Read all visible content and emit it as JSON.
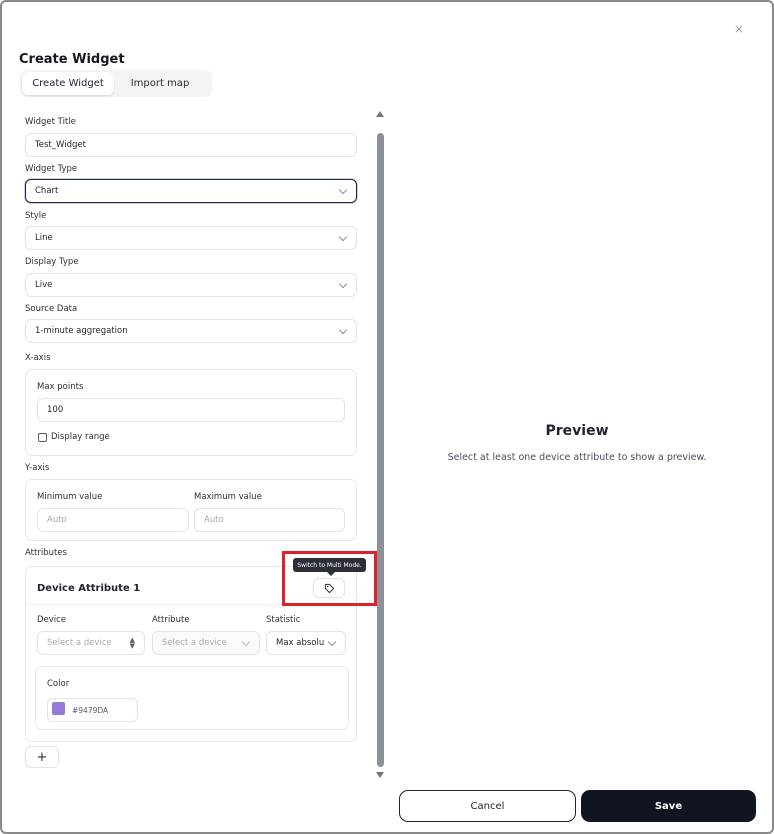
{
  "dialog": {
    "title": "Create Widget",
    "close_symbol": "×"
  },
  "tabs": [
    {
      "label": "Create Widget",
      "active": true
    },
    {
      "label": "Import map",
      "active": false
    }
  ],
  "form": {
    "widget_title": {
      "label": "Widget Title",
      "value": "Test_Widget"
    },
    "widget_type": {
      "label": "Widget Type",
      "value": "Chart"
    },
    "style": {
      "label": "Style",
      "value": "Line"
    },
    "display_type": {
      "label": "Display Type",
      "value": "Live"
    },
    "source_data": {
      "label": "Source Data",
      "value": "1-minute aggregation"
    },
    "x_axis": {
      "label": "X-axis",
      "max_points_label": "Max points",
      "max_points_value": "100",
      "display_range_label": "Display range",
      "display_range_checked": false
    },
    "y_axis": {
      "label": "Y-axis",
      "min_label": "Minimum value",
      "min_placeholder": "Auto",
      "max_label": "Maximum value",
      "max_placeholder": "Auto"
    },
    "attributes": {
      "label": "Attributes",
      "card_title": "Device Attribute 1",
      "tooltip": "Switch to Multi Mode.",
      "device_label": "Device",
      "device_placeholder": "Select a device",
      "attribute_label": "Attribute",
      "attribute_placeholder": "Select a device",
      "statistic_label": "Statistic",
      "statistic_value": "Max absolu",
      "color_label": "Color",
      "color_value": "#9479DA",
      "add_symbol": "+"
    }
  },
  "preview": {
    "title": "Preview",
    "message": "Select at least one device attribute to show a preview."
  },
  "footer": {
    "cancel_label": "Cancel",
    "save_label": "Save"
  },
  "colors": {
    "primary_dark": "#11151f",
    "highlight_red": "#e0202b",
    "attribute_color": "#9479DA"
  },
  "icons": [
    "close-icon",
    "chevron-down-icon",
    "tag-icon",
    "sort-arrows-icon",
    "plus-icon"
  ]
}
